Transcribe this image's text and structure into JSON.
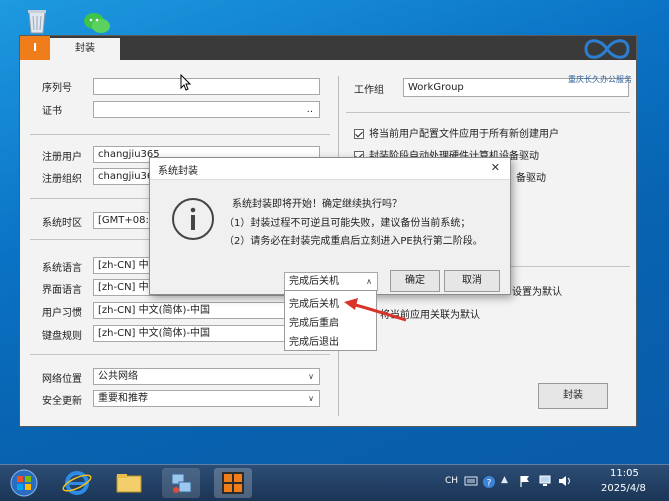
{
  "app": {
    "icon_label": "I",
    "tab_label": "封装"
  },
  "watermark": {
    "text": "重庆长久办公服务"
  },
  "form": {
    "serial_label": "序列号",
    "serial_value": "",
    "cert_label": "证书",
    "cert_browse": "..",
    "reg_user_label": "注册用户",
    "reg_user_value": "changjiu365",
    "reg_org_label": "注册组织",
    "reg_org_value": "changjiu36",
    "timezone_label": "系统时区",
    "timezone_value": "[GMT+08:0",
    "sys_lang_label": "系统语言",
    "sys_lang_value": "[zh-CN] 中",
    "ui_lang_label": "界面语言",
    "ui_lang_value": "[zh-CN] 中",
    "user_locale_label": "用户习惯",
    "user_locale_value": "[zh-CN] 中文(简体)-中国",
    "keyboard_label": "键盘规则",
    "keyboard_value": "[zh-CN] 中文(简体)-中国",
    "network_label": "网络位置",
    "network_value": "公共网络",
    "update_label": "安全更新",
    "update_value": "重要和推荐",
    "workgroup_label": "工作组",
    "workgroup_value": "WorkGroup"
  },
  "options": {
    "opt1": "将当前用户配置文件应用于所有新创建用户",
    "opt2": "封装阶段自动处理硬件计算机设备驱动",
    "opt3": "备驱动",
    "opt4": "设置为默认",
    "opt5": "将当前应用关联为默认"
  },
  "seal_button": "封装",
  "dialog": {
    "title": "系统封装",
    "message": "系统封装即将开始！确定继续执行吗？",
    "note1": "（1）封装过程不可逆且可能失败，建议备份当前系统；",
    "note2": "（2）请务必在封装完成重启后立刻进入PE执行第二阶段。",
    "select_value": "完成后关机",
    "ok_label": "确定",
    "cancel_label": "取消",
    "close_label": "✕"
  },
  "dropdown_options": [
    "完成后关机",
    "完成后重启",
    "完成后退出"
  ],
  "taskbar": {
    "ime": "CH",
    "time": "11:05",
    "date": "2025/4/8"
  },
  "colors": {
    "accent_orange": "#ef7d1a",
    "taskbar": "#1b3556",
    "arrow_red": "#d9342b"
  }
}
